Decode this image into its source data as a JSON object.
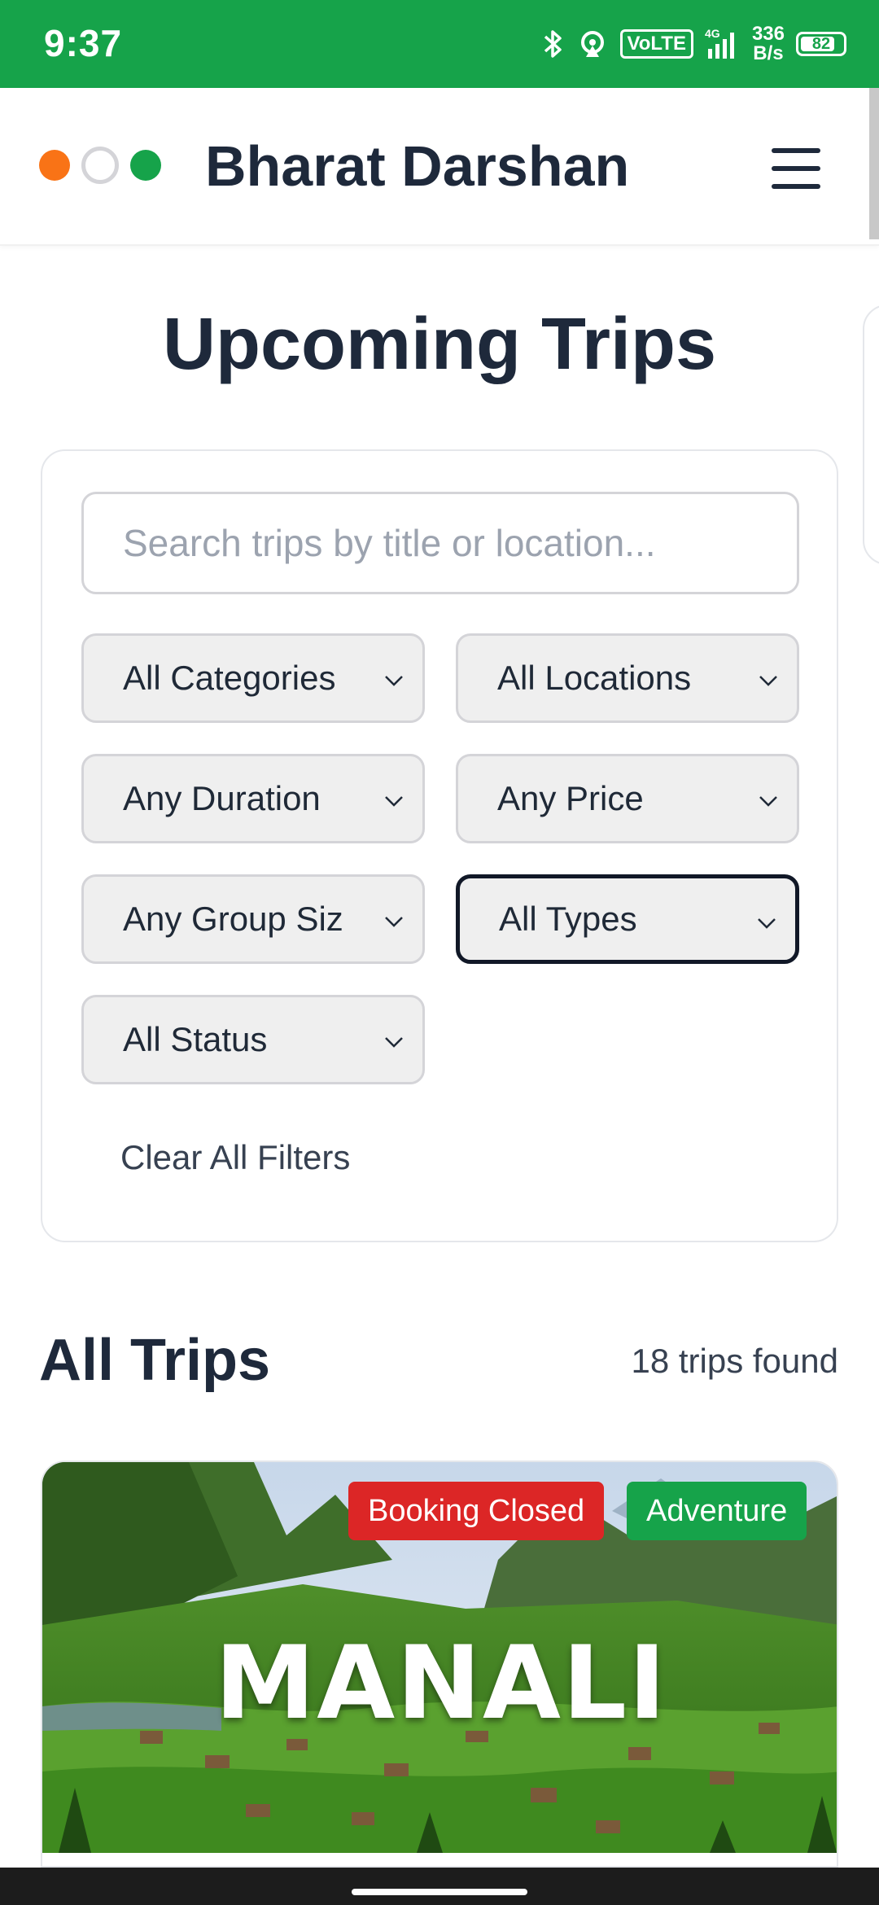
{
  "status_bar": {
    "time": "9:37",
    "network": "4G",
    "volte": "VoLTE",
    "speed_value": "336",
    "speed_unit": "B/s",
    "battery": "82",
    "battery_level": 0.82,
    "bg_color": "#16a34a"
  },
  "header": {
    "brand": "Bharat Darshan",
    "logo_colors": [
      "#f97316",
      "#ffffff",
      "#16a34a"
    ],
    "menu_icon": "hamburger-icon"
  },
  "page": {
    "title": "Upcoming Trips"
  },
  "filters": {
    "search_placeholder": "Search trips by title or location...",
    "search_value": "",
    "category": "All Categories",
    "location": "All Locations",
    "duration": "Any Duration",
    "price": "Any Price",
    "group_size": "Any Group Siz",
    "type": "All Types",
    "status": "All Status",
    "clear_label": "Clear All Filters"
  },
  "results": {
    "title": "All Trips",
    "count_label": "18 trips found"
  },
  "trips": [
    {
      "name": "MANALI",
      "status_badge": "Booking Closed",
      "category_badge": "Adventure",
      "status_color": "#dc2626",
      "category_color": "#16a34a"
    }
  ]
}
